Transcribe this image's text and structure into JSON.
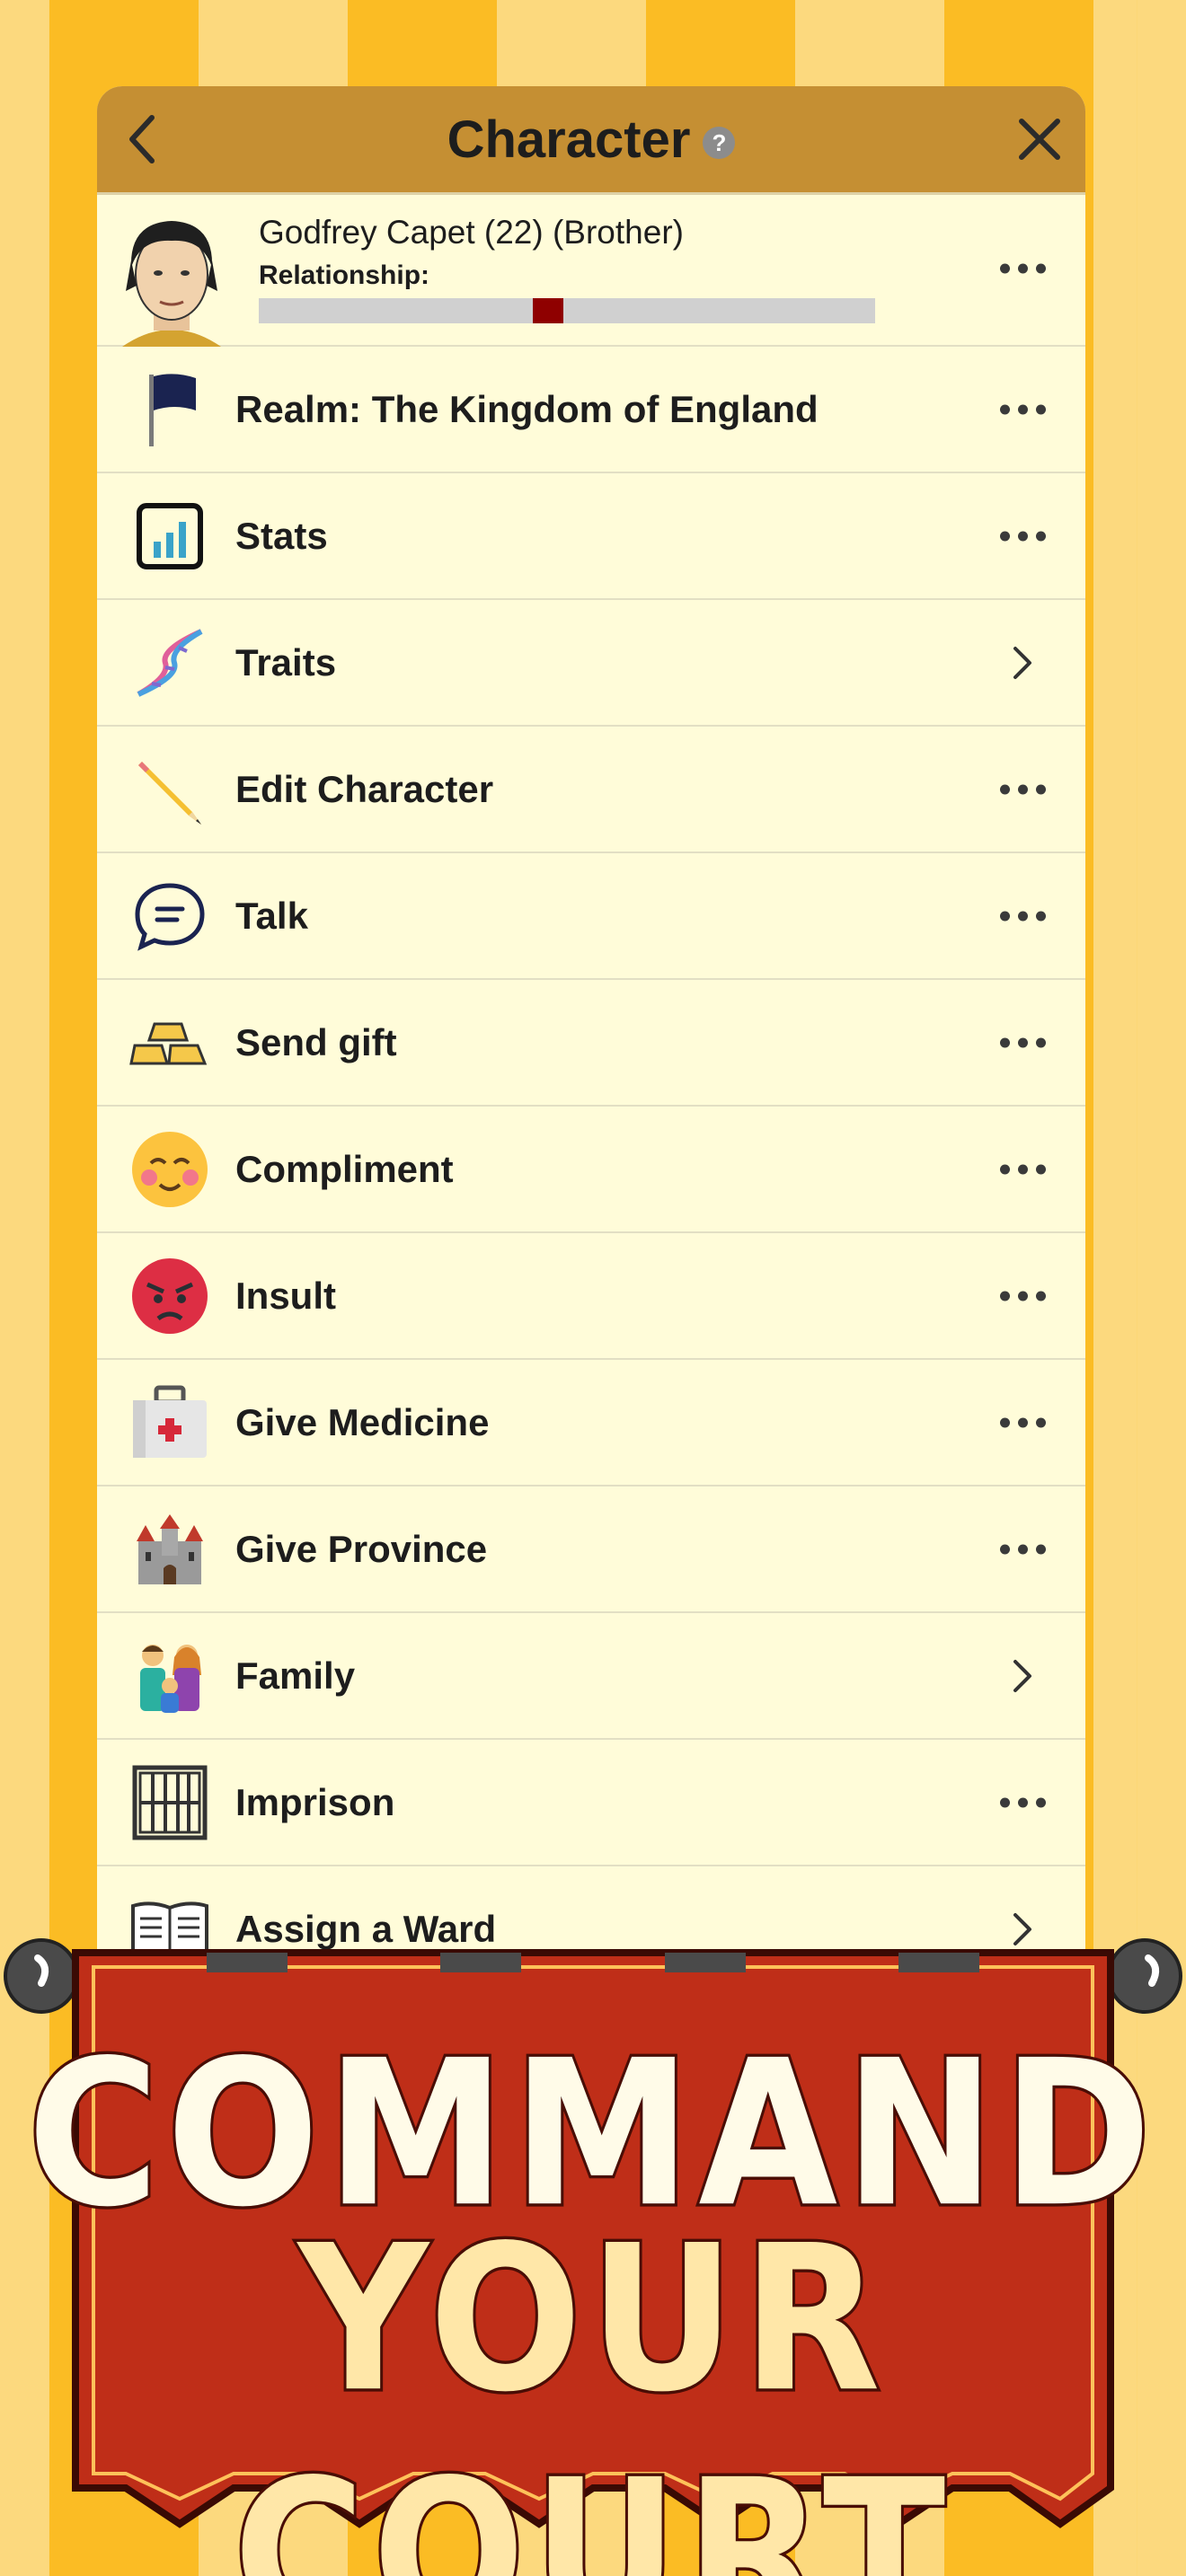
{
  "header": {
    "title": "Character"
  },
  "character": {
    "name": "Godfrey Capet (22) (Brother)",
    "relationship_label": "Relationship:",
    "relationship_value": 0.47
  },
  "menu": [
    {
      "label": "Realm: The Kingdom of England",
      "icon": "flag-icon",
      "action": "more"
    },
    {
      "label": "Stats",
      "icon": "stats-chart-icon",
      "action": "more"
    },
    {
      "label": "Traits",
      "icon": "dna-icon",
      "action": "chevron"
    },
    {
      "label": "Edit Character",
      "icon": "pencil-icon",
      "action": "more"
    },
    {
      "label": "Talk",
      "icon": "speech-bubble-icon",
      "action": "more"
    },
    {
      "label": "Send gift",
      "icon": "gold-bars-icon",
      "action": "more"
    },
    {
      "label": "Compliment",
      "icon": "blushing-face-icon",
      "action": "more"
    },
    {
      "label": "Insult",
      "icon": "angry-face-icon",
      "action": "more"
    },
    {
      "label": "Give Medicine",
      "icon": "medical-kit-icon",
      "action": "more"
    },
    {
      "label": "Give Province",
      "icon": "castle-icon",
      "action": "more"
    },
    {
      "label": "Family",
      "icon": "family-icon",
      "action": "chevron"
    },
    {
      "label": "Imprison",
      "icon": "prison-bars-icon",
      "action": "more"
    },
    {
      "label": "Assign a Ward",
      "icon": "open-book-icon",
      "action": "chevron"
    }
  ],
  "banner": {
    "line1": "COMMAND",
    "line2": "YOUR COURT"
  },
  "colors": {
    "header_bg": "#c58f33",
    "panel_bg": "#fffcd9",
    "banner_red": "#c2331a",
    "stripe_light": "#fcd97e",
    "stripe_dark": "#fbbc24"
  }
}
